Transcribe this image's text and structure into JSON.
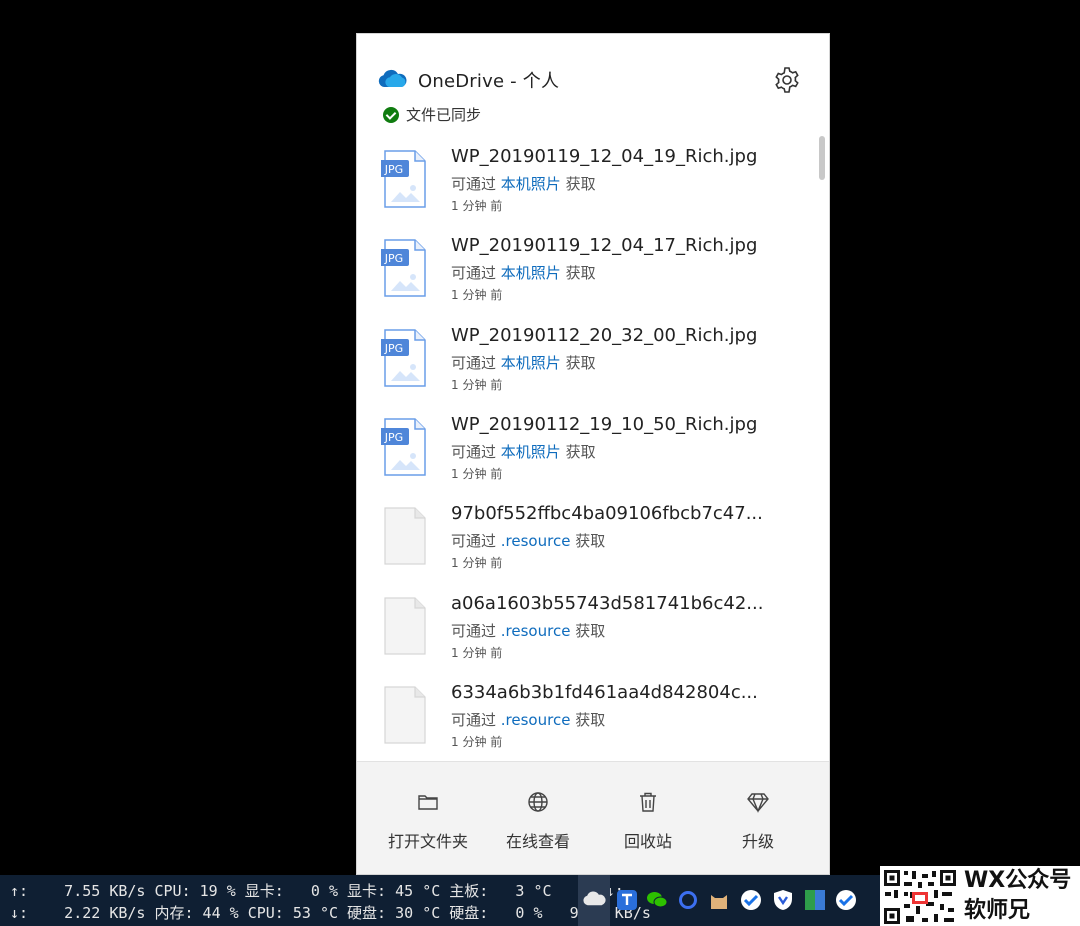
{
  "header": {
    "title": "OneDrive - 个人",
    "status": "文件已同步"
  },
  "files": [
    {
      "name": "WP_20190119_12_04_19_Rich.jpg",
      "pre": "可通过 ",
      "source": "本机照片",
      "post": " 获取",
      "time": "1 分钟 前",
      "type": "jpg",
      "badge": "JPG"
    },
    {
      "name": "WP_20190119_12_04_17_Rich.jpg",
      "pre": "可通过 ",
      "source": "本机照片",
      "post": " 获取",
      "time": "1 分钟 前",
      "type": "jpg",
      "badge": "JPG"
    },
    {
      "name": "WP_20190112_20_32_00_Rich.jpg",
      "pre": "可通过 ",
      "source": "本机照片",
      "post": " 获取",
      "time": "1 分钟 前",
      "type": "jpg",
      "badge": "JPG"
    },
    {
      "name": "WP_20190112_19_10_50_Rich.jpg",
      "pre": "可通过 ",
      "source": "本机照片",
      "post": " 获取",
      "time": "1 分钟 前",
      "type": "jpg",
      "badge": "JPG"
    },
    {
      "name": "97b0f552ffbc4ba09106fbcb7c47...",
      "pre": "可通过 ",
      "source": ".resource",
      "post": " 获取",
      "time": "1 分钟 前",
      "type": "blank",
      "badge": ""
    },
    {
      "name": "a06a1603b55743d581741b6c42...",
      "pre": "可通过 ",
      "source": ".resource",
      "post": " 获取",
      "time": "1 分钟 前",
      "type": "blank",
      "badge": ""
    },
    {
      "name": "6334a6b3b1fd461aa4d842804c...",
      "pre": "可通过 ",
      "source": ".resource",
      "post": " 获取",
      "time": "1 分钟 前",
      "type": "blank",
      "badge": ""
    }
  ],
  "footer": {
    "open_folder": "打开文件夹",
    "view_online": "在线查看",
    "recycle_bin": "回收站",
    "upgrade": "升级"
  },
  "taskbar": {
    "line1": "↑:    7.55 KB/s CPU: 19 % 显卡:   0 % 显卡: 45 °C 主板:   3 °C     ↑↓:",
    "line2": "↓:    2.22 KB/s 内存: 44 % CPU: 53 °C 硬盘: 30 °C 硬盘:   0 %   9.77 KB/s"
  },
  "watermark": {
    "line1": "WX公众号",
    "line2": "软师兄"
  },
  "colors": {
    "accent": "#0f6cbd",
    "synced": "#107c10",
    "jpg_badge": "#3a7bd5",
    "taskbar": "#0f1f33"
  },
  "icons": [
    "onedrive-cloud-icon",
    "gear-icon",
    "check-circle-icon",
    "jpg-file-icon",
    "blank-file-icon",
    "folder-icon",
    "globe-icon",
    "trash-icon",
    "diamond-icon"
  ]
}
